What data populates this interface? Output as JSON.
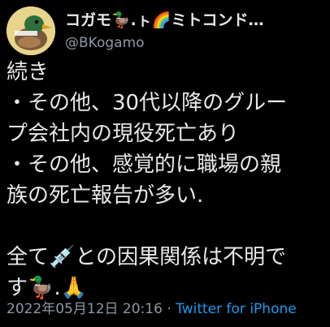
{
  "author": {
    "display_name": "コガモ🦆.ㇳ🌈ミトコンド…",
    "handle": "@BKogamo",
    "avatar_icon": "duck-avatar-icon"
  },
  "tweet": {
    "lines": [
      "続き",
      "・その他、30代以降のグルー",
      "プ会社内の現役死亡あり",
      "・その他、感覚的に職場の親",
      "族の死亡報告が多い.",
      "",
      "全て💉との因果関係は不明で",
      "す🦆.🙏"
    ]
  },
  "meta": {
    "timestamp": "2022年05月12日 20:16",
    "separator": " · ",
    "source": "Twitter for iPhone"
  },
  "colors": {
    "background": "#000000",
    "text": "#e7e9ea",
    "secondary": "#8b98a5",
    "link": "#1d9bf0"
  }
}
